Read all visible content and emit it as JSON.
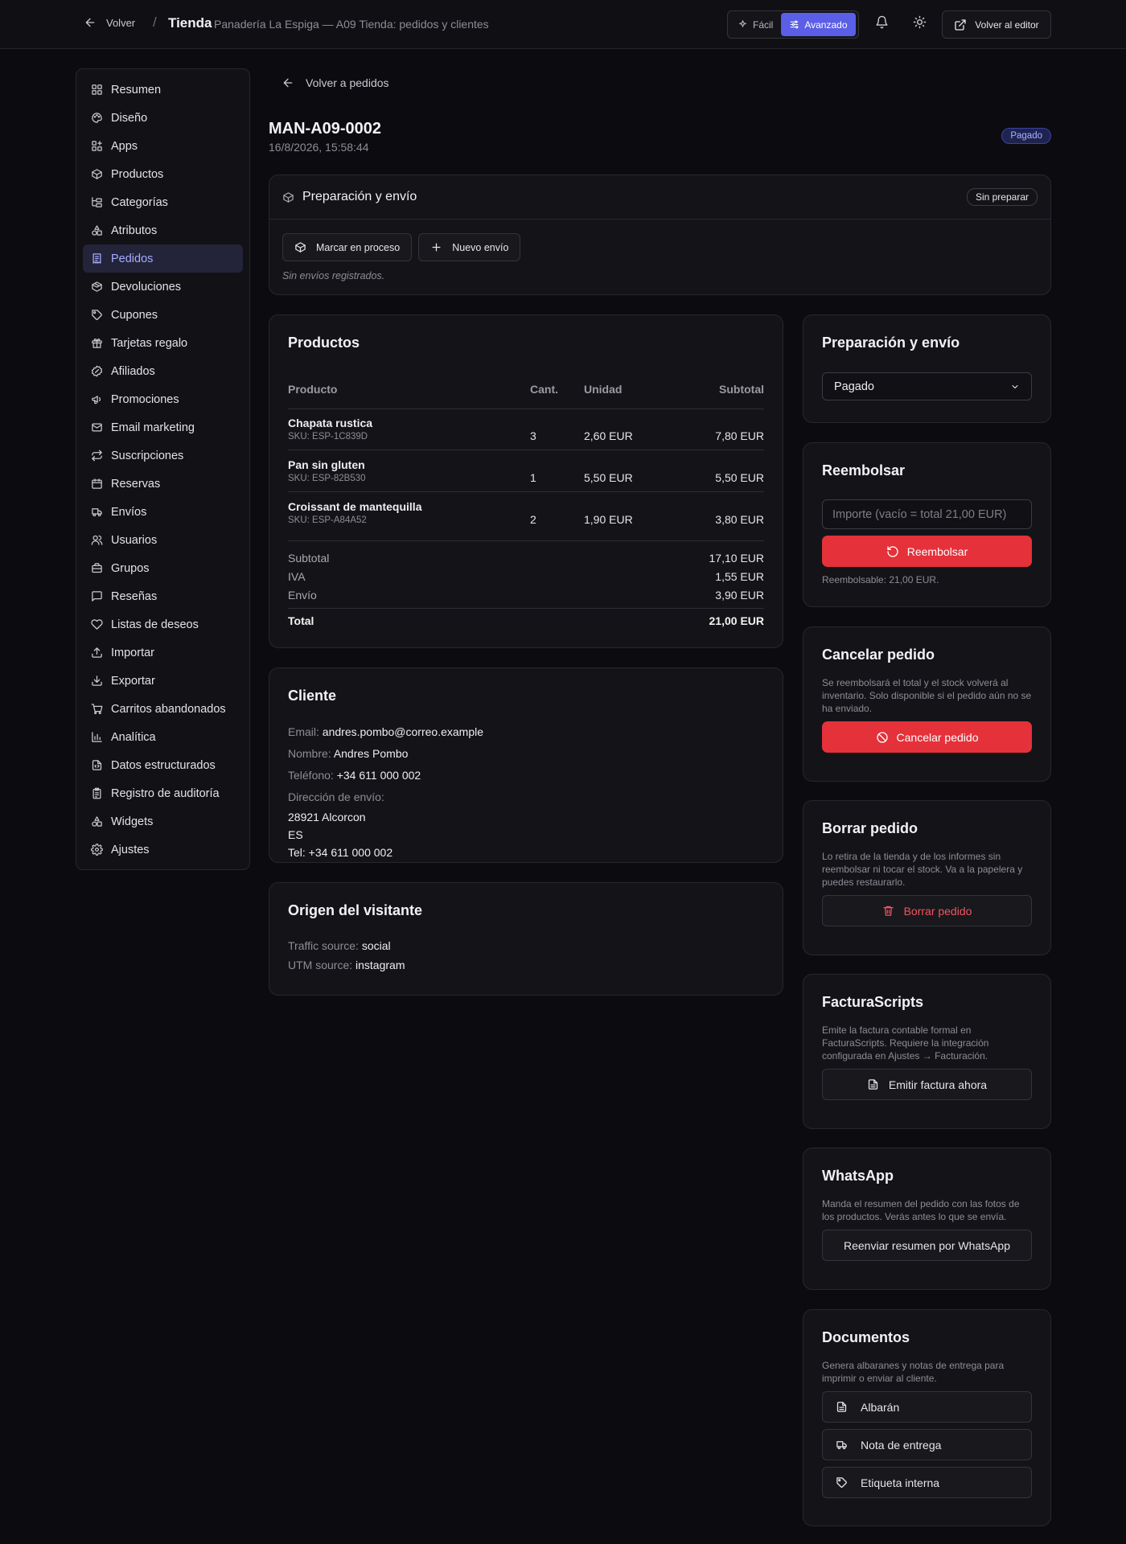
{
  "topbar": {
    "back_label": "Volver",
    "separator": "/",
    "brand": "Tienda",
    "breadcrumb": "Panadería La Espiga — A09 Tienda: pedidos y clientes",
    "mode_easy": "Fácil",
    "mode_advanced": "Avanzado",
    "editor_label": "Volver al editor"
  },
  "sidebar": {
    "items": [
      {
        "label": "Resumen",
        "icon": "layout-grid-icon"
      },
      {
        "label": "Diseño",
        "icon": "palette-icon"
      },
      {
        "label": "Apps",
        "icon": "apps-icon"
      },
      {
        "label": "Productos",
        "icon": "package-icon"
      },
      {
        "label": "Categorías",
        "icon": "folder-tree-icon"
      },
      {
        "label": "Atributos",
        "icon": "shapes-icon"
      },
      {
        "label": "Pedidos",
        "icon": "receipt-icon"
      },
      {
        "label": "Devoluciones",
        "icon": "package-return-icon"
      },
      {
        "label": "Cupones",
        "icon": "tag-icon"
      },
      {
        "label": "Tarjetas regalo",
        "icon": "gift-icon"
      },
      {
        "label": "Afiliados",
        "icon": "badge-percent-icon"
      },
      {
        "label": "Promociones",
        "icon": "megaphone-icon"
      },
      {
        "label": "Email marketing",
        "icon": "mail-icon"
      },
      {
        "label": "Suscripciones",
        "icon": "repeat-icon"
      },
      {
        "label": "Reservas",
        "icon": "calendar-icon"
      },
      {
        "label": "Envíos",
        "icon": "truck-icon"
      },
      {
        "label": "Usuarios",
        "icon": "users-icon"
      },
      {
        "label": "Grupos",
        "icon": "briefcase-icon"
      },
      {
        "label": "Reseñas",
        "icon": "message-square-icon"
      },
      {
        "label": "Listas de deseos",
        "icon": "heart-icon"
      },
      {
        "label": "Importar",
        "icon": "upload-icon"
      },
      {
        "label": "Exportar",
        "icon": "download-icon"
      },
      {
        "label": "Carritos abandonados",
        "icon": "shopping-cart-icon"
      },
      {
        "label": "Analítica",
        "icon": "bar-chart-icon"
      },
      {
        "label": "Datos estructurados",
        "icon": "file-code-icon"
      },
      {
        "label": "Registro de auditoría",
        "icon": "clipboard-list-icon"
      },
      {
        "label": "Widgets",
        "icon": "shapes-icon"
      },
      {
        "label": "Ajustes",
        "icon": "gear-icon"
      }
    ],
    "active_index": 6
  },
  "order": {
    "back_label": "Volver a pedidos",
    "id": "MAN-A09-0002",
    "date": "16/8/2026, 15:58:44",
    "status_badge": "Pagado"
  },
  "prep": {
    "title": "Preparación y envío",
    "status": "Sin preparar",
    "btn_process": "Marcar en proceso",
    "btn_new_shipment": "Nuevo envío",
    "empty": "Sin envíos registrados."
  },
  "products": {
    "title": "Productos",
    "headers": {
      "product": "Producto",
      "qty": "Cant.",
      "unit": "Unidad",
      "subtotal": "Subtotal"
    },
    "rows": [
      {
        "name": "Chapata rustica",
        "sku": "SKU: ESP-1C839D",
        "qty": "3",
        "unit": "2,60 EUR",
        "subtotal": "7,80 EUR"
      },
      {
        "name": "Pan sin gluten",
        "sku": "SKU: ESP-82B530",
        "qty": "1",
        "unit": "5,50 EUR",
        "subtotal": "5,50 EUR"
      },
      {
        "name": "Croissant de mantequilla",
        "sku": "SKU: ESP-A84A52",
        "qty": "2",
        "unit": "1,90 EUR",
        "subtotal": "3,80 EUR"
      }
    ],
    "totals": [
      {
        "label": "Subtotal",
        "value": "17,10 EUR"
      },
      {
        "label": "IVA",
        "value": "1,55 EUR"
      },
      {
        "label": "Envío",
        "value": "3,90 EUR"
      }
    ],
    "grand_total": {
      "label": "Total",
      "value": "21,00 EUR"
    }
  },
  "customer": {
    "title": "Cliente",
    "email_label": "Email:",
    "email": "andres.pombo@correo.example",
    "name_label": "Nombre:",
    "name": "Andres Pombo",
    "phone_label": "Teléfono:",
    "phone": "+34 611 000 002",
    "address_label": "Dirección de envío:",
    "address_lines": [
      "28921 Alcorcon",
      "ES",
      "Tel: +34 611 000 002"
    ]
  },
  "origin": {
    "title": "Origen del visitante",
    "traffic_label": "Traffic source:",
    "traffic": "social",
    "utm_label": "UTM source:",
    "utm": "instagram"
  },
  "right": {
    "status_card": {
      "title": "Preparación y envío",
      "selected": "Pagado"
    },
    "refund": {
      "title": "Reembolsar",
      "placeholder": "Importe (vacío = total 21,00 EUR)",
      "button": "Reembolsar",
      "note": "Reembolsable: 21,00 EUR."
    },
    "cancel": {
      "title": "Cancelar pedido",
      "desc": "Se reembolsará el total y el stock volverá al inventario. Solo disponible si el pedido aún no se ha enviado.",
      "button": "Cancelar pedido"
    },
    "delete": {
      "title": "Borrar pedido",
      "desc": "Lo retira de la tienda y de los informes sin reembolsar ni tocar el stock. Va a la papelera y puedes restaurarlo.",
      "button": "Borrar pedido"
    },
    "invoice": {
      "title": "FacturaScripts",
      "desc": "Emite la factura contable formal en FacturaScripts. Requiere la integración configurada en Ajustes → Facturación.",
      "button": "Emitir factura ahora"
    },
    "whatsapp": {
      "title": "WhatsApp",
      "desc": "Manda el resumen del pedido con las fotos de los productos. Verás antes lo que se envía.",
      "button": "Reenviar resumen por WhatsApp"
    },
    "documents": {
      "title": "Documentos",
      "desc": "Genera albaranes y notas de entrega para imprimir o enviar al cliente.",
      "buttons": [
        "Albarán",
        "Nota de entrega",
        "Etiqueta interna"
      ]
    }
  },
  "colors": {
    "background": "#0c0c10",
    "card": "#141418",
    "accent": "#5b5ee6",
    "danger": "#e5313a"
  }
}
